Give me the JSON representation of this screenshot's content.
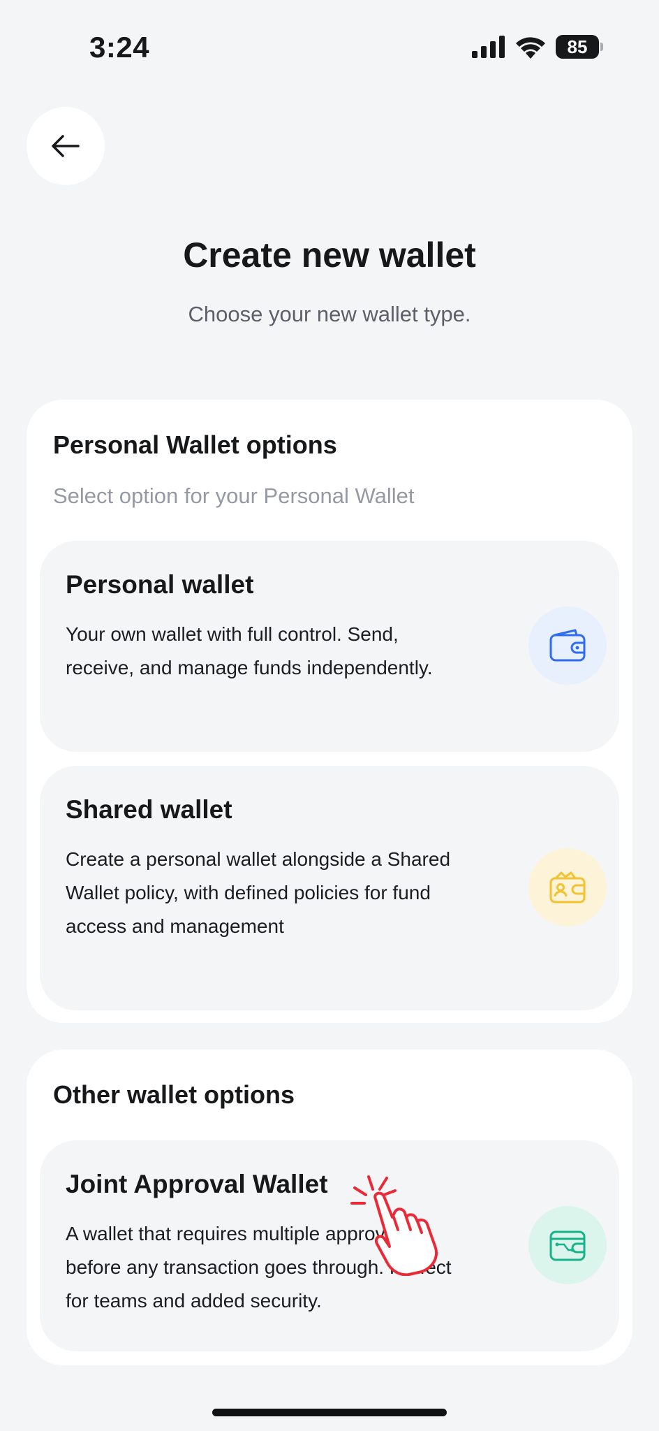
{
  "status_bar": {
    "time": "3:24",
    "battery_level": "85",
    "icons": [
      "signal-icon",
      "wifi-icon",
      "battery-icon"
    ]
  },
  "header": {
    "back_icon": "arrow-left-icon",
    "title": "Create new wallet",
    "subtitle": "Choose your new wallet type."
  },
  "personal_section": {
    "title": "Personal Wallet options",
    "subtitle": "Select option for your Personal Wallet",
    "options": [
      {
        "title": "Personal wallet",
        "description": "Your own wallet with full control. Send, receive, and manage funds independently.",
        "icon": "wallet-icon",
        "icon_color": "#2f6bf2",
        "icon_bg": "#e8effd"
      },
      {
        "title": "Shared wallet",
        "description": "Create a personal wallet alongside a Shared Wallet policy, with defined policies for fund access and management",
        "icon": "shared-wallet-icon",
        "icon_color": "#f2c230",
        "icon_bg": "#fdf3d8"
      }
    ]
  },
  "other_section": {
    "title": "Other wallet options",
    "options": [
      {
        "title": "Joint Approval Wallet",
        "description": "A wallet that requires multiple approvals before any transaction goes through. Perfect for teams and added security.",
        "icon": "joint-wallet-icon",
        "icon_color": "#17b28a",
        "icon_bg": "#dcf5ec"
      }
    ]
  },
  "overlay": {
    "icon": "tap-hand-icon",
    "color": "#ea2a36"
  }
}
